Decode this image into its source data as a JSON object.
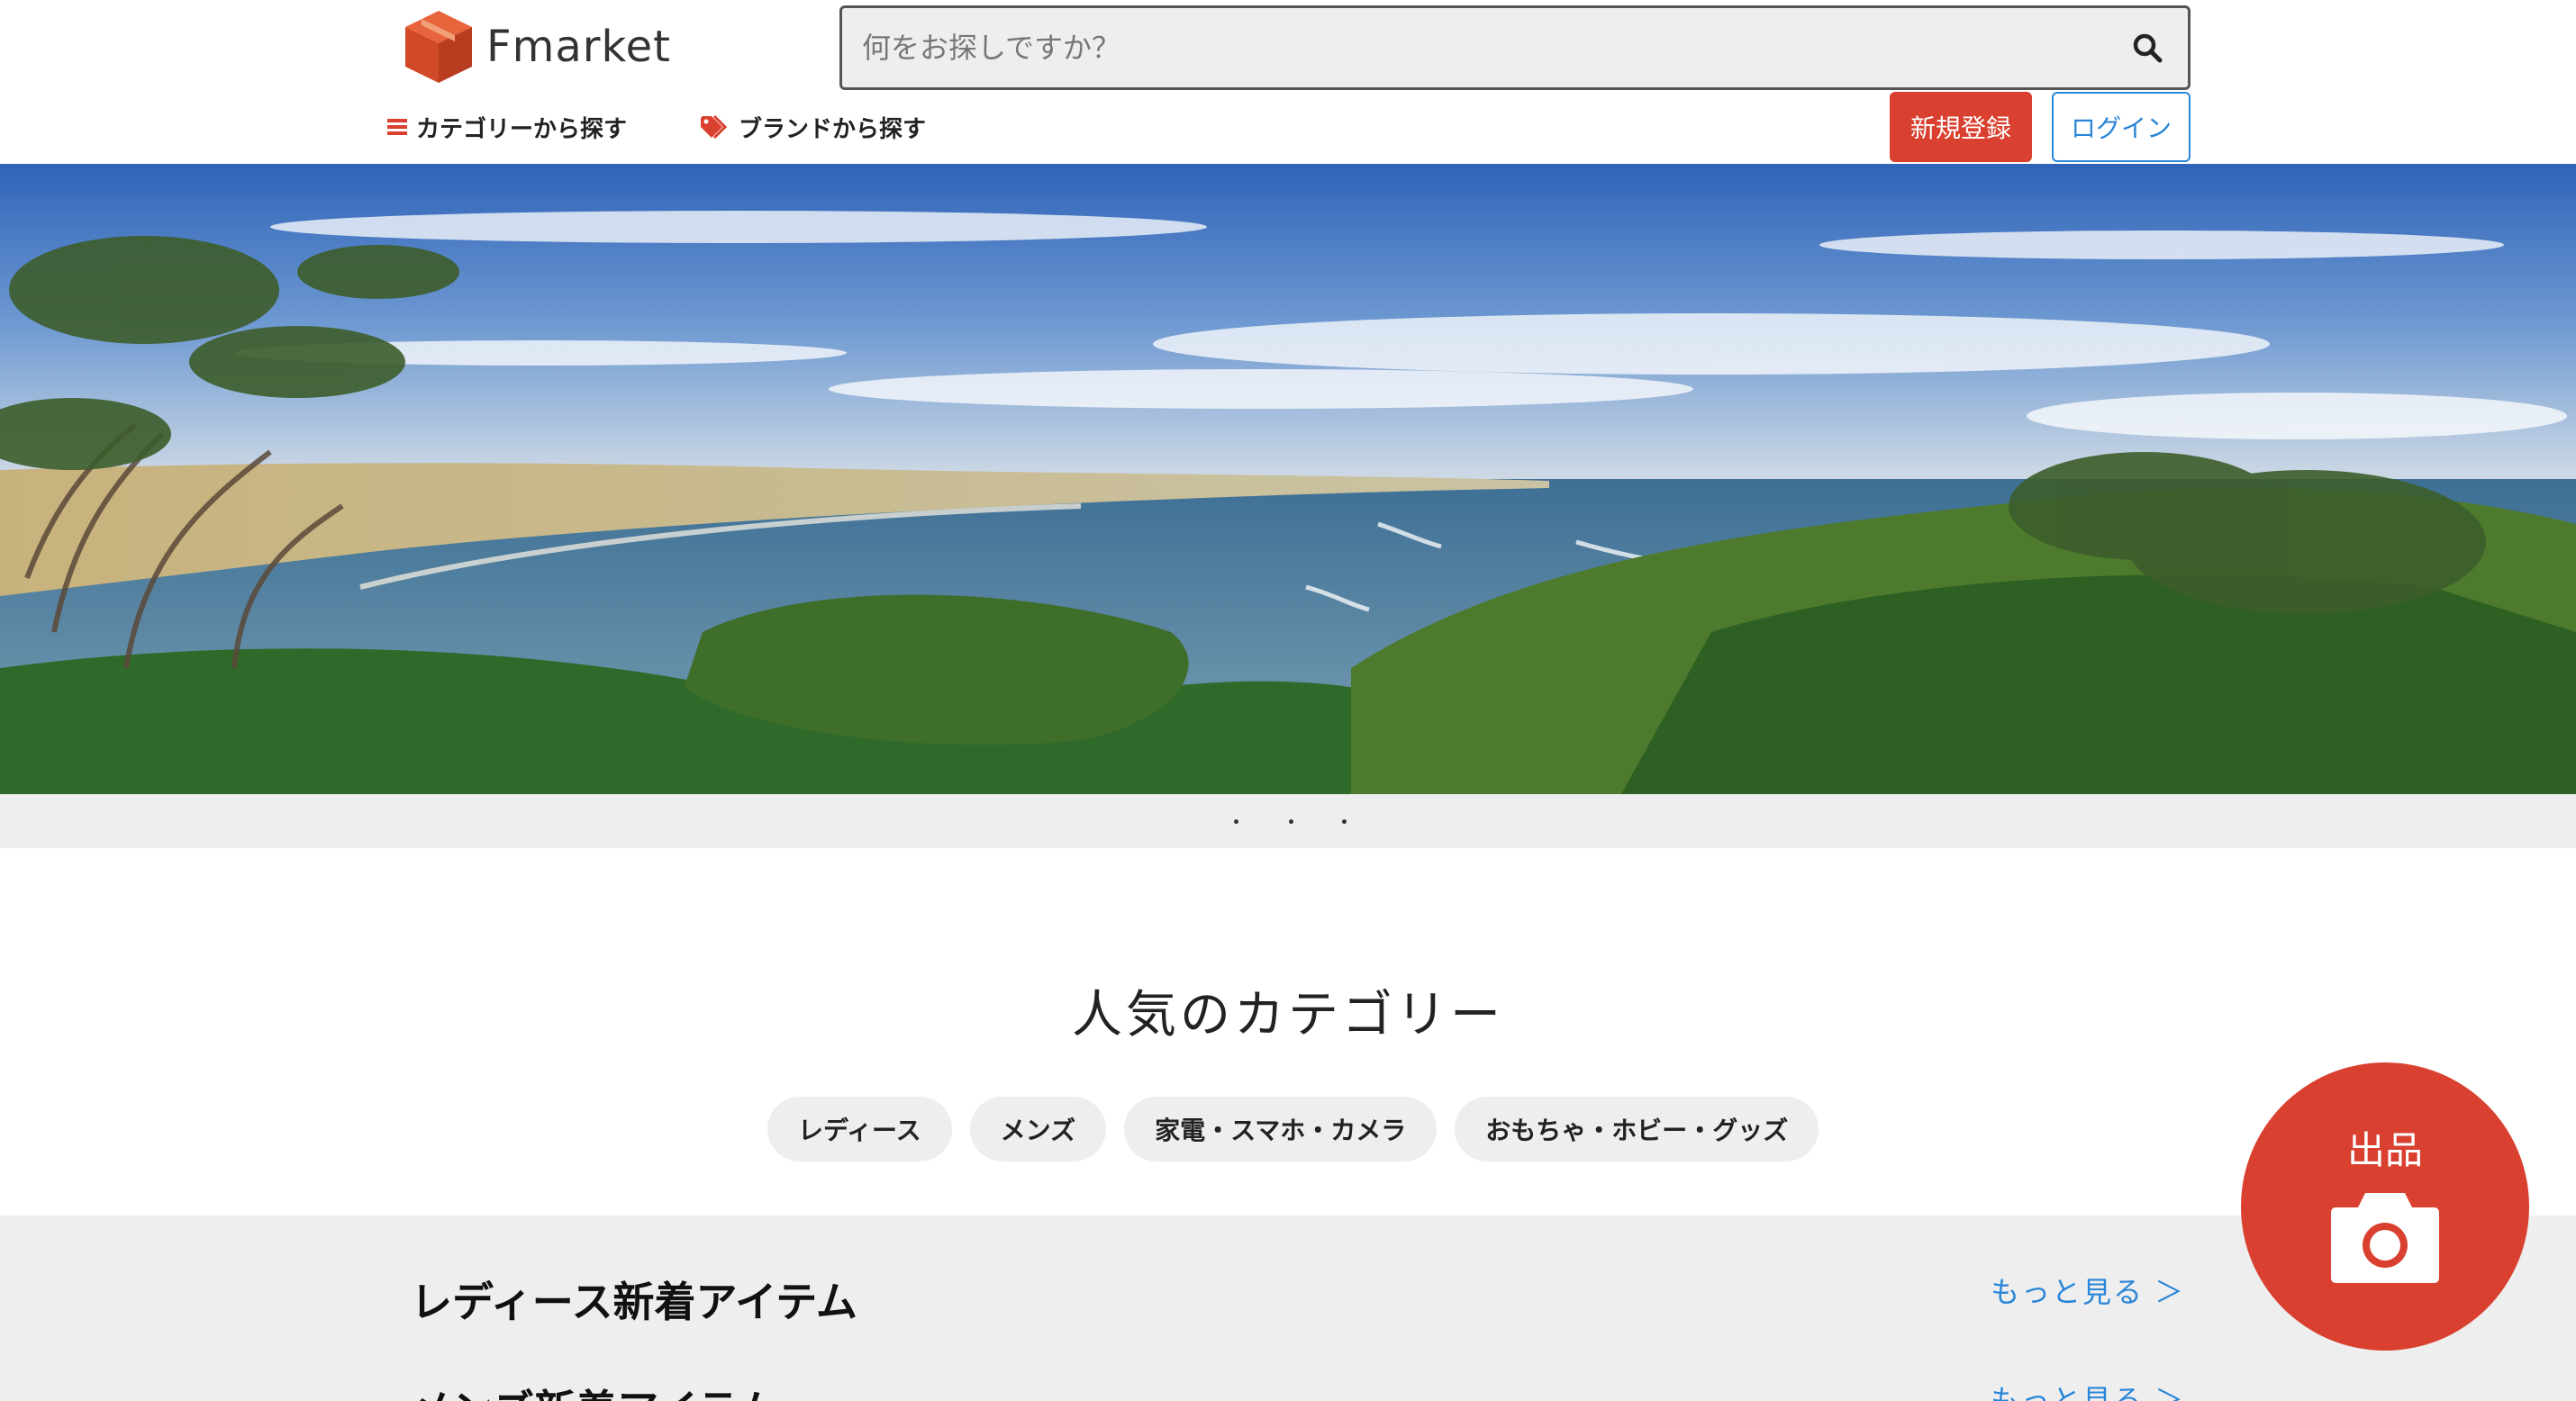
{
  "brand": {
    "name": "Fmarket"
  },
  "search": {
    "placeholder": "何をお探しですか？"
  },
  "nav": {
    "category_label": "カテゴリーから探す",
    "brand_label": "ブランドから探す"
  },
  "auth": {
    "signup_label": "新規登録",
    "login_label": "ログイン"
  },
  "popular": {
    "title": "人気のカテゴリー",
    "categories": [
      "レディース",
      "メンズ",
      "家電・スマホ・カメラ",
      "おもちゃ・ホビー・グッズ"
    ]
  },
  "sections": [
    {
      "title": "レディース新着アイテム",
      "more": "もっと見る ＞"
    },
    {
      "title": "メンズ新着アイテム",
      "more": "もっと見る ＞"
    }
  ],
  "sell": {
    "label": "出品"
  },
  "icons": {
    "logo": "cube-icon",
    "search": "search-icon",
    "category": "list-icon",
    "brand": "tag-icon",
    "sell": "camera-icon"
  },
  "colors": {
    "accent_red": "#d9402f",
    "link_blue": "#2a86d8",
    "section_gray": "#eeeeee"
  },
  "carousel": {
    "slide_count": 3
  }
}
